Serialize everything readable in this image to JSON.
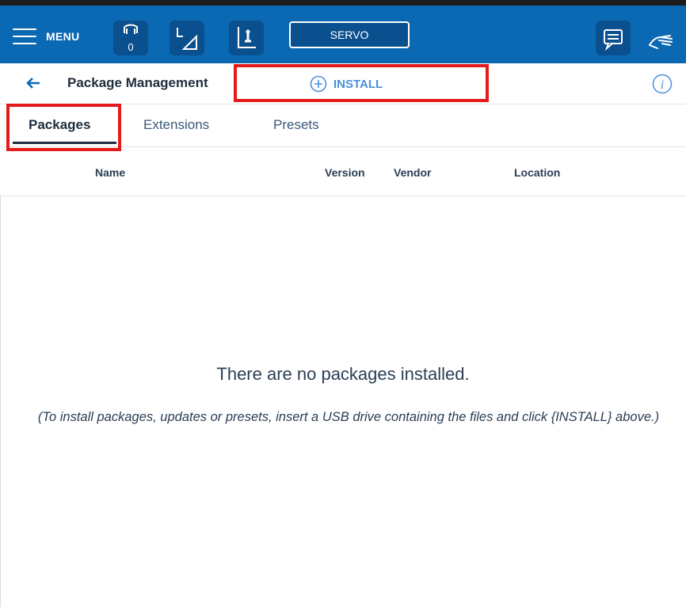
{
  "topbar": {
    "menu_label": "MENU",
    "gripper_count": "0",
    "servo_label": "SERVO"
  },
  "header": {
    "title": "Package Management",
    "install_label": "INSTALL"
  },
  "tabs": [
    {
      "label": "Packages",
      "active": true
    },
    {
      "label": "Extensions",
      "active": false
    },
    {
      "label": "Presets",
      "active": false
    }
  ],
  "table": {
    "columns": [
      "Name",
      "Version",
      "Vendor",
      "Location"
    ]
  },
  "empty_state": {
    "message": "There are no packages installed.",
    "hint": "(To install packages, updates or presets, insert a USB drive containing the files and click {INSTALL} above.)"
  },
  "colors": {
    "topbar": "#0b68b3",
    "highlight": "#e51a1a",
    "accent": "#4a90d9"
  },
  "icons": [
    "menu-icon",
    "gripper-icon",
    "frame-icon",
    "axis-icon",
    "chat-icon",
    "hand-icon",
    "back-arrow-icon",
    "plus-circle-icon",
    "info-icon"
  ]
}
